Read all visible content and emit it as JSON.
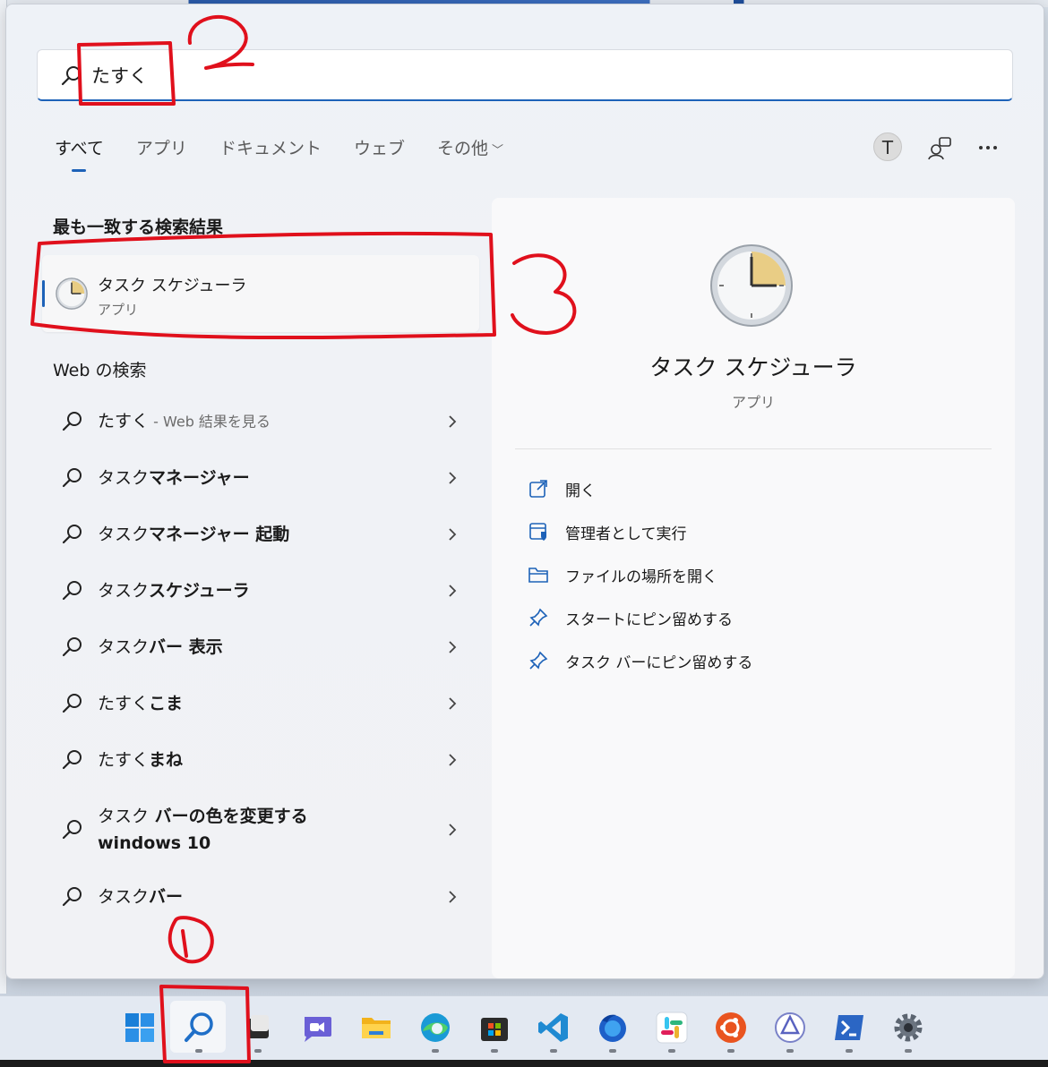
{
  "search": {
    "value": "たすく"
  },
  "tabs": [
    {
      "label": "すべて"
    },
    {
      "label": "アプリ"
    },
    {
      "label": "ドキュメント"
    },
    {
      "label": "ウェブ"
    },
    {
      "label": "その他"
    }
  ],
  "user": {
    "initial": "T"
  },
  "best_match": {
    "title": "最も一致する検索結果",
    "name": "タスク スケジューラ",
    "type": "アプリ"
  },
  "web": {
    "title": "Web の検索",
    "first": {
      "query": "たすく",
      "suffix": " - Web 結果を見る"
    },
    "items": [
      {
        "prefix": "タスク",
        "rest": "マネージャー"
      },
      {
        "prefix": "タスク",
        "rest": "マネージャー 起動"
      },
      {
        "prefix": "タスク",
        "rest": "スケジューラ"
      },
      {
        "prefix": "タスク",
        "rest": "バー 表示"
      },
      {
        "prefix": "たすく",
        "rest": "こま"
      },
      {
        "prefix": "たすく",
        "rest": "まね"
      },
      {
        "prefix": "タスク",
        "rest": " バーの色を変更する windows 10"
      },
      {
        "prefix": "タスク",
        "rest": "バー"
      }
    ]
  },
  "detail": {
    "name": "タスク スケジューラ",
    "type": "アプリ",
    "actions": [
      {
        "label": "開く"
      },
      {
        "label": "管理者として実行"
      },
      {
        "label": "ファイルの場所を開く"
      },
      {
        "label": "スタートにピン留めする"
      },
      {
        "label": "タスク バーにピン留めする"
      }
    ]
  },
  "annotations": [
    "1",
    "2",
    "3"
  ],
  "colors": {
    "accent": "#1d62b8",
    "annotation": "#e0101c"
  }
}
